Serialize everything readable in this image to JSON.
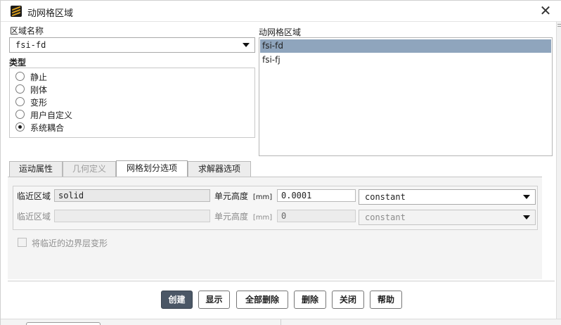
{
  "window": {
    "title": "动网格区域",
    "close_glyph": "✕",
    "icon": "ansys-fluent-logo"
  },
  "zone_name": {
    "label": "区域名称",
    "value": "fsi-fd"
  },
  "type": {
    "label": "类型",
    "options": [
      {
        "label": "静止",
        "selected": false
      },
      {
        "label": "刚体",
        "selected": false
      },
      {
        "label": "变形",
        "selected": false
      },
      {
        "label": "用户自定义",
        "selected": false
      },
      {
        "label": "系统耦合",
        "selected": true
      }
    ]
  },
  "dynamic_zones": {
    "label": "动网格区域",
    "items": [
      {
        "label": "fsi-fd",
        "selected": true
      },
      {
        "label": "fsi-fj",
        "selected": false
      }
    ]
  },
  "tabs": [
    {
      "label": "运动属性",
      "state": "normal"
    },
    {
      "label": "几何定义",
      "state": "disabled"
    },
    {
      "label": "网格划分选项",
      "state": "active"
    },
    {
      "label": "求解器选项",
      "state": "normal"
    }
  ],
  "meshing": {
    "rows": [
      {
        "adjacent_label": "临近区域",
        "adjacent_value": "solid",
        "height_label": "单元高度",
        "unit": "[mm]",
        "height_value": "0.0001",
        "method": "constant",
        "enabled": true
      },
      {
        "adjacent_label": "临近区域",
        "adjacent_value": "",
        "height_label": "单元高度",
        "unit": "[mm]",
        "height_value": "0",
        "method": "constant",
        "enabled": false
      }
    ],
    "boundary_layer_label": "将临近的边界层变形",
    "boundary_layer_checked": false
  },
  "buttons": {
    "create": "创建",
    "display": "显示",
    "delete_all": "全部删除",
    "delete": "删除",
    "close": "关闭",
    "help": "帮助"
  },
  "colors": {
    "selection": "#8fa5bd",
    "primary_button": "#4b5766",
    "icon_accent": "#e0a21c"
  }
}
